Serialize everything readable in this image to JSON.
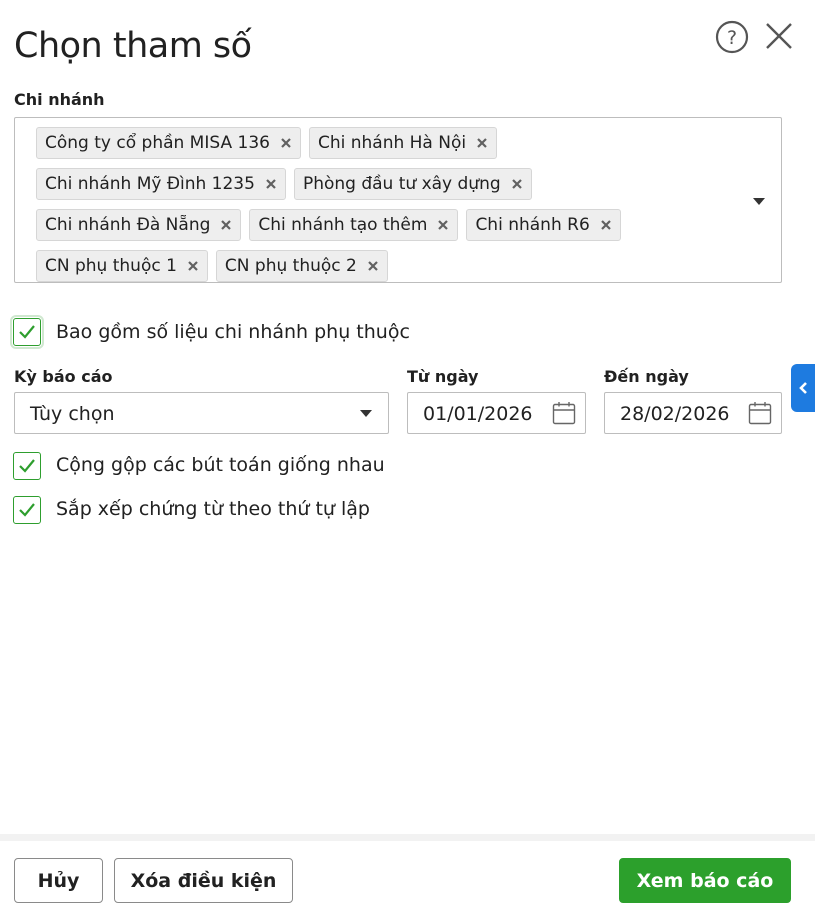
{
  "dialog": {
    "title": "Chọn tham số"
  },
  "branch": {
    "label": "Chi nhánh",
    "tag_rows": [
      [
        "Công ty cổ phần MISA 136",
        "Chi nhánh Hà Nội"
      ],
      [
        "Chi nhánh Mỹ Đình 1235",
        "Phòng đầu tư xây dựng"
      ],
      [
        "Chi nhánh Đà Nẵng",
        "Chi nhánh tạo thêm",
        "Chi nhánh R6"
      ],
      [
        "CN phụ thuộc 1",
        "CN phụ thuộc 2"
      ]
    ]
  },
  "include_dependent": {
    "label": "Bao gồm số liệu chi nhánh phụ thuộc",
    "checked": true
  },
  "period": {
    "label": "Kỳ báo cáo",
    "value": "Tùy chọn"
  },
  "from_date": {
    "label": "Từ ngày",
    "value": "01/01/2026"
  },
  "to_date": {
    "label": "Đến ngày",
    "value": "28/02/2026"
  },
  "merge_entries": {
    "label": "Cộng gộp các bút toán giống nhau",
    "checked": true
  },
  "sort_vouchers": {
    "label": "Sắp xếp chứng từ theo thứ tự lập",
    "checked": true
  },
  "footer": {
    "cancel": "Hủy",
    "clear": "Xóa điều kiện",
    "view_report": "Xem báo cáo"
  },
  "colors": {
    "accent_green": "#2ca02c",
    "side_tab_blue": "#1e7be0"
  }
}
